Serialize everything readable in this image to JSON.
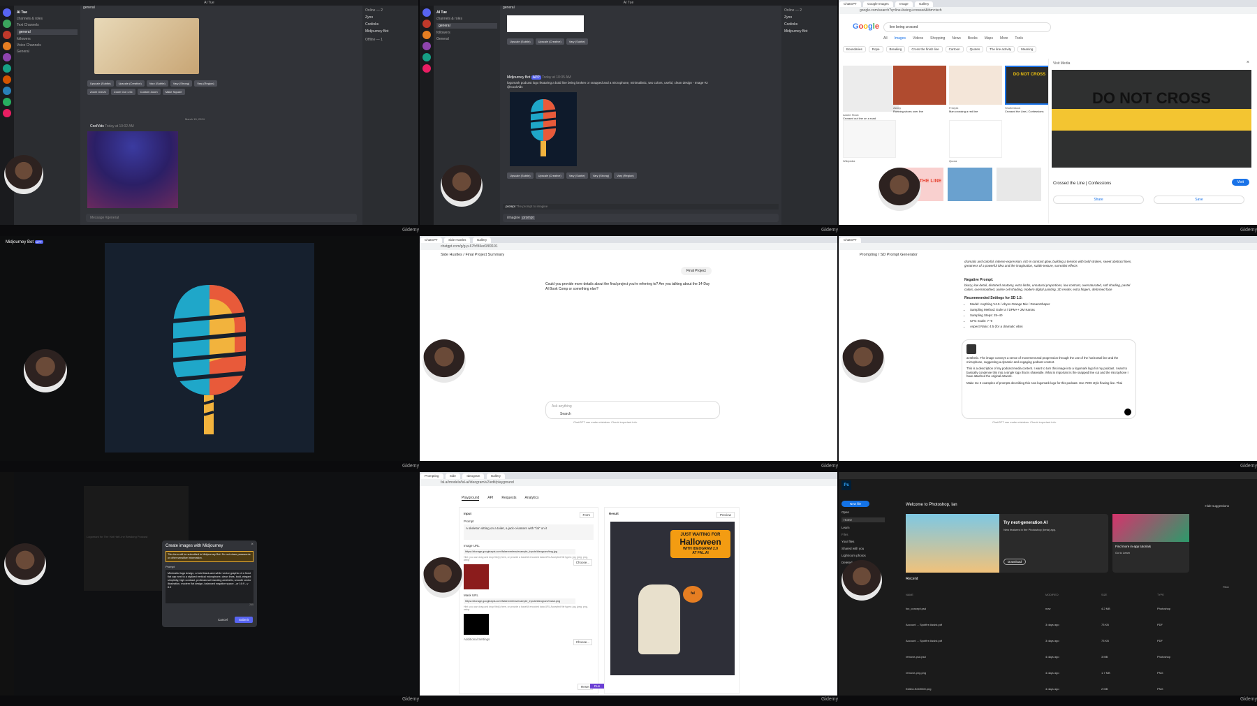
{
  "footer_brand": "Gidemy",
  "discord": {
    "server_name": "AI Tue",
    "channel": "general",
    "channel_text": "channels & roles",
    "text_channels_header": "Text Channels",
    "channel_general": "general",
    "channel_followers": "followers",
    "voice_header": "Voice Channels",
    "voice_general": "General",
    "members_online": "Online — 2",
    "member_1": "Zyno",
    "member_2": "Coolinks",
    "member_3": "Midjourney Bot",
    "offline": "Offline — 1",
    "date_divider": "March 15, 2024",
    "username": "CoolVids",
    "user_time": "Today at 10:02 AM",
    "buttons_row1": [
      "Upscale (Subtle)",
      "Upscale (Creative)",
      "Vary (Subtle)",
      "Vary (Strong)",
      "Vary (Region)"
    ],
    "buttons_row2": [
      "Zoom Out 2x",
      "Zoom Out 1.5x",
      "Custom Zoom",
      "Make Square"
    ],
    "web_label": "Web",
    "message_placeholder": "Message #general",
    "bot_name": "Midjourney Bot",
    "bot_badge": "APP",
    "bot_time": "Today at 10:05 AM",
    "bot_prompt": "logomark podcast logo featuring a bold line being broken or snapped and a microphone, minimalistic, two colors, useful, clean design - Image #2 @CoolVids",
    "slash_prompt": "prompt",
    "slash_hint": "The prompt to imagine",
    "imagine_cmd": "/imagine",
    "imagine_prompt": "prompt"
  },
  "google": {
    "tabs": [
      "ChatGPT",
      "Google Images",
      "Image",
      "Gallery"
    ],
    "url": "google.com/search?q=line+being+crossed&tbm=isch",
    "search_text": "line being crossed",
    "nav": [
      "All",
      "Images",
      "Videos",
      "Shopping",
      "News",
      "Books",
      "Maps",
      "More",
      "Tools"
    ],
    "chips": [
      "Boundaries",
      "Rope",
      "Breaking",
      "Cross the finish line",
      "Cartoon",
      "Quotes",
      "The line activity",
      "Meaning"
    ],
    "results": [
      {
        "src": "Adobe Stock",
        "title": "Crossed out line on a road"
      },
      {
        "src": "Alamy",
        "title": "Running shoes over line"
      },
      {
        "src": "Freepik",
        "title": "Man crossing a red line"
      },
      {
        "src": "Shutterstock",
        "title": "Crossed the Line | Confessions"
      },
      {
        "src": "Wikipedia",
        "title": "Line diagram"
      },
      {
        "src": "Quora",
        "title": "Crossing the line"
      }
    ],
    "panel_source": "Visit Media",
    "panel_image_text": "DO NOT CROSS",
    "panel_title": "Crossed the Line | Confessions",
    "visit_button": "Visit",
    "share_button": "Share",
    "save_button": "Save",
    "cross_line_text": "CROSS THE LINE"
  },
  "mj_full": {
    "bot_name": "Midjourney Bot",
    "badge": "APP"
  },
  "chatgpt1": {
    "tabs": [
      "ChatGPT",
      "Side Hustles",
      "Gallery"
    ],
    "url": "chatgpt.com/g/g-p-67fc5f4ed1f83191",
    "breadcrumb_1": "Side Hustles",
    "breadcrumb_2": "Final Project Summary",
    "user_msg": "Final Project",
    "assistant_msg": "Could you provide more details about the final project you're referring to? Are you talking about the 14-Day AI Book Comp or something else?",
    "input_placeholder": "Ask anything",
    "search_label": "Search",
    "disclaimer": "ChatGPT can make mistakes. Check important info."
  },
  "chatgpt2": {
    "breadcrumb_1": "Prompting",
    "breadcrumb_2": "SD Prompt Generator",
    "para1": "dramatic and colorful, intense expression, rich in contrast glow, building a tension with bold strokes, sweet abstract lines, greatness of a powerful idea and the imagination, subtle texture, surrealist effects",
    "neg_header": "Negative Prompt:",
    "neg_text": "blurry, low detail, distorted anatomy, extra limbs, unnatural proportions, low contrast, oversaturated, soft shading, pastel colors, oversmoothed, anime cell shading, modern digital painting, 3D render, extra fingers, deformed face",
    "settings_header": "Recommended Settings for SD 1.5:",
    "settings": [
      "Model: Anything V4.5 / Abyss Orange Mix / DreamShaper",
      "Sampling Method: Euler a / DPM++ 2M Karras",
      "Sampling Steps: 25–40",
      "CFG Scale: 7–9",
      "Aspect Ratio: 4:5 (for a dramatic vibe)"
    ],
    "user_text": "aesthetic. The image conveys a sense of movement and progression through the use of the horizontal line and the microphone, suggesting a dynamic and engaging podcast content.",
    "user_text2": "This is a description of my podcast media content. I want to turn this image into a logomark logo for my podcast. I want to basically condense this into a single logo that is shareable. What is important is the snapped line cut and the microphone I have attached the original artwork.",
    "user_text3": "Make me 2 examples of prompts describing this new logomark logo for this podcast. Use 720X style flowing line. Thai",
    "disclaimer": "ChatGPT can make mistakes. Check important info."
  },
  "modal": {
    "title": "Create images with Midjourney",
    "warning": "This form will be submitted to Midjourney Bot. Do not share passwords or other sensitive information.",
    "prompt_label": "Prompt",
    "prompt_text": "Minimalist logo design, a bold black-and-white vector graphic of a fixed flat cap next to a stylized vertical microphone, clean lines, bold, elegant simplicity, high contrast, professional branding aesthetic, smooth vector illustration, modern flat design, balanced negative space --ar 16:9 --v 6.0",
    "count": "265",
    "cancel": "Cancel",
    "submit": "Submit",
    "description": "Logomark for The Hat Hat Line Breaking Podcast"
  },
  "ideogram": {
    "tabs": [
      "Prompting",
      "Side",
      "Ideogram",
      "Gallery"
    ],
    "url": "fal.ai/models/fal-ai/ideogram/v2/edit/playground",
    "nav": [
      "Playground",
      "API",
      "Requests",
      "Analytics"
    ],
    "input_header": "Input",
    "form_btn": "Form",
    "prompt_label": "Prompt",
    "prompt_value": "A skeleton sitting on a toilet, a jack-o-lantern with \"fal\" on it",
    "image_url_label": "Image URL",
    "image_url": "https://storage.googleapis.com/falserverless/example_inputs/ideogram/img.jpg",
    "choose": "Choose...",
    "hint": "Hint: you can drag and drop file(s) here, or provide a base64 encoded data URL Accepted file types: jpg, jpeg, png, webp",
    "mask_url_label": "Mask URL",
    "mask_url": "https://storage.googleapis.com/falserverless/example_inputs/ideogram/mask.png",
    "additional": "Additional Settings",
    "reset": "Reset",
    "run": "Run",
    "result_header": "Result",
    "preview": "Preview",
    "poster_line1": "JUST WAITING FOR",
    "poster_line2": "Halloween",
    "poster_line3": "WITH IDEOGRAM 2.0",
    "poster_line4": "AT FAL.AI",
    "pumpkin_text": "fal"
  },
  "photoshop": {
    "app": "Ps",
    "welcome": "Welcome to Photoshop, Ian",
    "new_file": "New file",
    "open": "Open",
    "nav": [
      "Home",
      "Learn"
    ],
    "files_header": "Files",
    "files": [
      "Your files",
      "Shared with you",
      "Lightroom photos",
      "Deleted"
    ],
    "hide": "Hide suggestions",
    "card_title": "Try next-generation AI",
    "card_sub": "New features in the Photoshop (beta) app.",
    "download": "Download",
    "card2_title": "Find more in-app tutorials",
    "card2_link": "Go to Learn",
    "recent": "Recent",
    "filter": "Filter",
    "columns": [
      "NAME",
      "MODIFIED",
      "SIZE",
      "TYPE"
    ],
    "rows": [
      {
        "name": "fox_concept.psd",
        "modified": "now",
        "size": "4.2 MB",
        "type": "Photoshop"
      },
      {
        "name": "Account ... Spotfire Assist.pdf",
        "modified": "3 days ago",
        "size": "73 KB",
        "type": "PDF"
      },
      {
        "name": "Account ... Spotfire Assist.pdf",
        "modified": "3 days ago",
        "size": "73 KB",
        "type": "PDF"
      },
      {
        "name": "remove-psd.psd",
        "modified": "4 days ago",
        "size": "3 MB",
        "type": "Photoshop"
      },
      {
        "name": "remove-png.png",
        "modified": "4 days ago",
        "size": "1.7 MB",
        "type": "PNG"
      },
      {
        "name": "Edited-Seb9000.png",
        "modified": "4 days ago",
        "size": "2 MB",
        "type": "PNG"
      }
    ]
  }
}
